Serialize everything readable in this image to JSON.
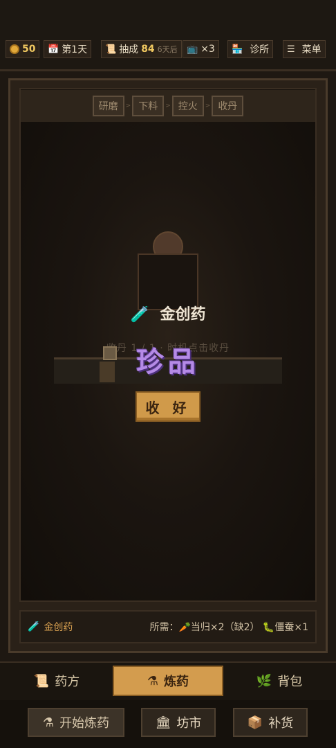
{
  "topbar": {
    "gold": "50",
    "day_label": "第1天",
    "commission_label": "抽成",
    "commission_value": "84",
    "commission_due": "6天后",
    "ad_label": "×3",
    "clinic_label": "诊所",
    "menu_label": "菜单"
  },
  "steps": [
    "研磨",
    "下料",
    "控火",
    "收丹"
  ],
  "hint": "收丹 1 / 1 · 时机点击收丹",
  "result": {
    "name": "金创药",
    "quality": "珍品",
    "quality_color": "#b58ae6",
    "collect_label": "收 好"
  },
  "recipe_info": {
    "name": "金创药",
    "requirements": "所需：🥕当归×2（缺2） 🐛僵蚕×1"
  },
  "tabs": [
    {
      "label": "药方",
      "icon": "scroll-icon"
    },
    {
      "label": "炼药",
      "icon": "flask-icon"
    },
    {
      "label": "背包",
      "icon": "herb-icon"
    }
  ],
  "actions": [
    {
      "label": "开始炼药",
      "icon": "flask-icon"
    },
    {
      "label": "坊市",
      "icon": "market-icon"
    },
    {
      "label": "补货",
      "icon": "box-icon"
    }
  ],
  "colors": {
    "accent": "#d39c4e",
    "gold": "#f0c860",
    "quality_rare": "#b58ae6"
  }
}
